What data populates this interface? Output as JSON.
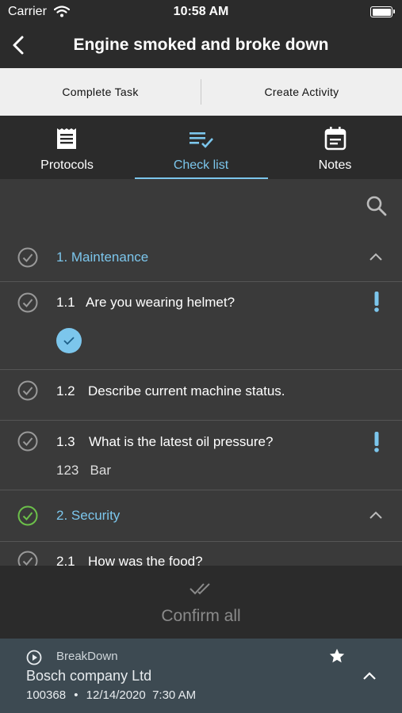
{
  "status_bar": {
    "carrier": "Carrier",
    "time": "10:58 AM"
  },
  "nav": {
    "title": "Engine smoked and broke down",
    "back_icon": "chevron-left-icon"
  },
  "actions": {
    "complete_task": "Complete Task",
    "create_activity": "Create Activity"
  },
  "tabs": [
    {
      "label": "Protocols",
      "icon": "receipt-icon",
      "active": false
    },
    {
      "label": "Check list",
      "icon": "checklist-icon",
      "active": true
    },
    {
      "label": "Notes",
      "icon": "calendar-icon",
      "active": false
    }
  ],
  "colors": {
    "accent": "#7cc6ec",
    "success": "#6cc04a",
    "dark_bg": "#2b2b2b",
    "content_bg": "#3a3a3a",
    "panel_bg": "#3d4a52"
  },
  "checklist": {
    "sections": [
      {
        "title": "1. Maintenance",
        "status": "pending",
        "questions": [
          {
            "number": "1.1",
            "text": "Are you wearing helmet?",
            "required": true,
            "answer": "checked"
          },
          {
            "number": "1.2",
            "text": "Describe current machine status.",
            "required": false,
            "answer": ""
          },
          {
            "number": "1.3",
            "text": "What is the latest oil pressure?",
            "required": true,
            "answer": "123   Bar"
          }
        ]
      },
      {
        "title": "2. Security",
        "status": "complete",
        "questions": [
          {
            "number": "2.1",
            "text": "How was the food?"
          }
        ]
      }
    ]
  },
  "confirm": {
    "label": "Confirm all"
  },
  "task": {
    "type": "BreakDown",
    "company": "Bosch company Ltd",
    "id": "100368",
    "separator": "•",
    "datetime": "12/14/2020  7:30 AM"
  }
}
